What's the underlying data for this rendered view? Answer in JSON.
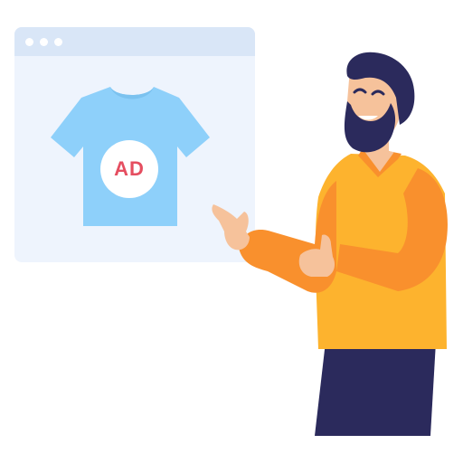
{
  "ad_window": {
    "badge_text": "AD",
    "badge_color": "#E54E60",
    "shirt_color": "#8ED0FA",
    "window_color": "#EEF4FD",
    "titlebar_color": "#D9E6F7"
  },
  "icons": {
    "window": "browser-window-icon",
    "shirt": "tshirt-icon",
    "person": "bearded-man-pointing"
  },
  "colors": {
    "sweater": "#FDB32E",
    "sleeve": "#F9902D",
    "pants": "#2B2A5C",
    "hair": "#2B2A5C",
    "skin": "#F6C29B"
  }
}
